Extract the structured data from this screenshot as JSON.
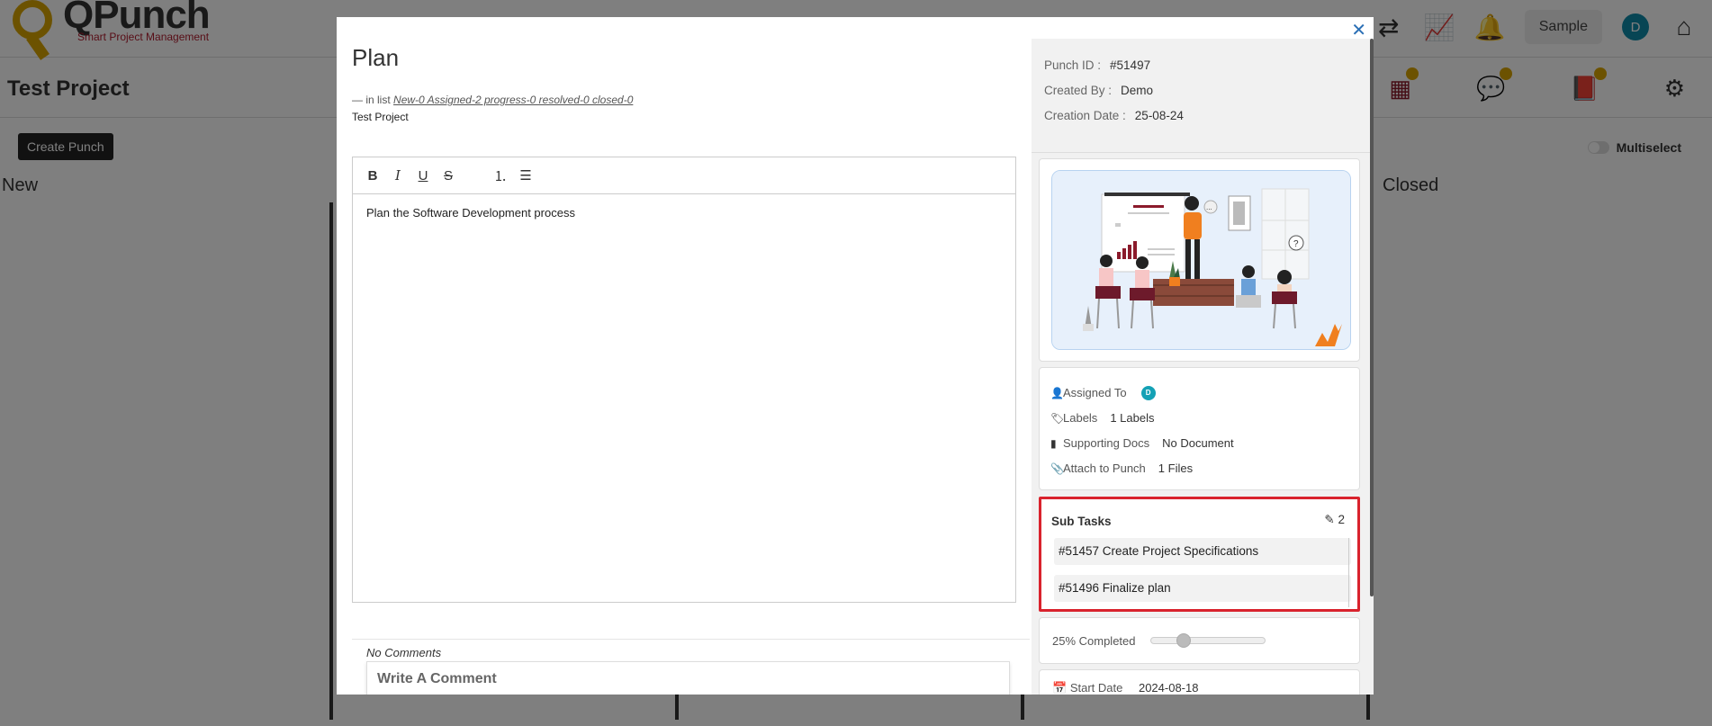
{
  "app": {
    "logo_name": "QPunch",
    "logo_tagline": "Smart Project Management",
    "sample_label": "Sample",
    "user_initial": "D"
  },
  "project": {
    "title": "Test Project",
    "create_button": "Create Punch",
    "multiselect_label": "Multiselect",
    "columns": {
      "new": "New",
      "closed": "Closed"
    }
  },
  "modal": {
    "title": "Plan",
    "in_list_prefix": "— in list",
    "in_list_link": "New-0 Assigned-2 progress-0 resolved-0 closed-0",
    "project_name": "Test Project",
    "editor_text": "Plan the Software Development process",
    "no_comments": "No Comments",
    "comment_placeholder": "Write A Comment"
  },
  "meta": {
    "punch_id_label": "Punch ID :",
    "punch_id": "#51497",
    "created_by_label": "Created By :",
    "created_by": "Demo",
    "creation_date_label": "Creation Date :",
    "creation_date": "25-08-24"
  },
  "info": {
    "assigned_label": "Assigned To",
    "assigned_initial": "D",
    "labels_label": "Labels",
    "labels_value": "1 Labels",
    "docs_label": "Supporting Docs",
    "docs_value": "No Document",
    "attach_label": "Attach to Punch",
    "attach_value": "1 Files"
  },
  "subtasks": {
    "title": "Sub Tasks",
    "count": "2",
    "items": [
      {
        "label": "#51457 Create Project Specifications"
      },
      {
        "label": "#51496 Finalize plan"
      }
    ]
  },
  "progress": {
    "label": "25% Completed",
    "value": 25
  },
  "dates": {
    "start_label": "Start Date",
    "start_value": "2024-08-18"
  },
  "colors": {
    "accent_red": "#d9232d",
    "brand_maroon": "#8b1a2b",
    "brand_gold": "#d9a400",
    "avatar_teal": "#0f8aa8"
  }
}
